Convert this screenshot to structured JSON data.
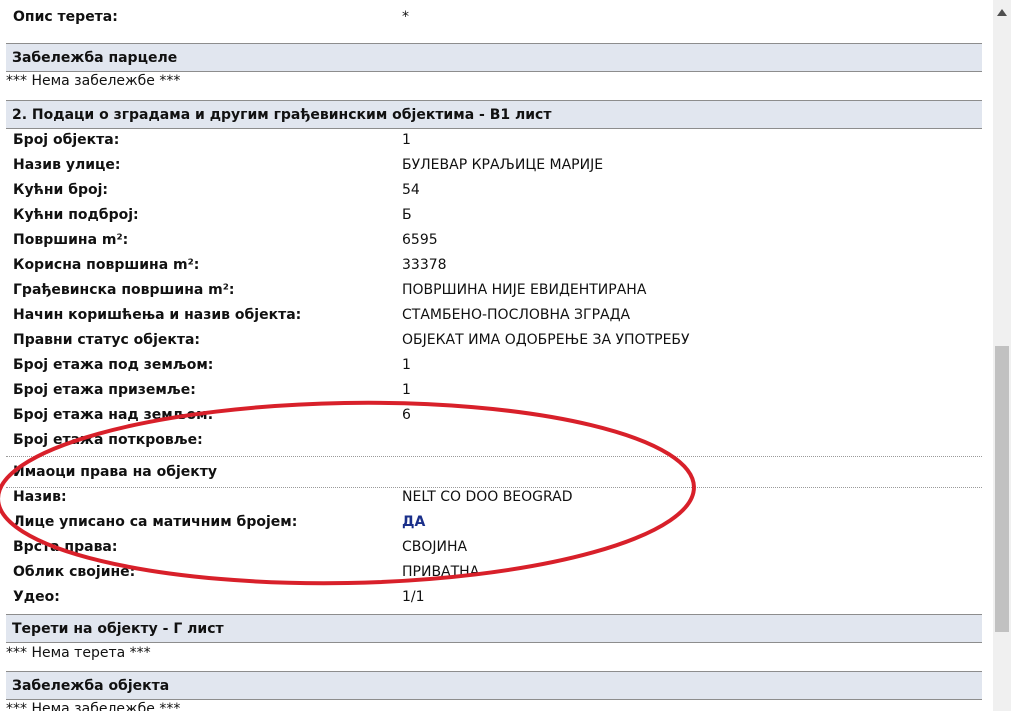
{
  "top_row": {
    "label": "Опис терета:",
    "value": "*"
  },
  "parcel_note": {
    "title": "Забележба парцеле",
    "text": "*** Нема забележбе ***"
  },
  "buildings": {
    "title": "2. Подаци о зградама и другим грађевинским објектима - В1 лист",
    "rows": [
      {
        "label": "Број објекта:",
        "value": "1"
      },
      {
        "label": "Назив улице:",
        "value": "БУЛЕВАР КРАЉИЦЕ МАРИЈЕ"
      },
      {
        "label": "Кућни број:",
        "value": "54"
      },
      {
        "label": "Кућни подброј:",
        "value": "Б"
      },
      {
        "label": "Површина m²:",
        "value": "6595"
      },
      {
        "label": "Корисна површина m²:",
        "value": "33378"
      },
      {
        "label": "Грађевинска површина m²:",
        "value": "ПОВРШИНА НИЈЕ ЕВИДЕНТИРАНА"
      },
      {
        "label": "Начин коришћења и назив објекта:",
        "value": "СТАМБЕНО-ПОСЛОВНА ЗГРАДА"
      },
      {
        "label": "Правни статус објекта:",
        "value": "ОБЈЕКАТ ИМА ОДОБРЕЊЕ ЗА УПОТРЕБУ"
      },
      {
        "label": "Број етажа под земљом:",
        "value": "1"
      },
      {
        "label": "Број етажа приземље:",
        "value": "1"
      },
      {
        "label": "Број етажа над земљом:",
        "value": "6"
      },
      {
        "label": "Број етажа поткровље:",
        "value": ""
      }
    ]
  },
  "owners": {
    "title": "Имаоци права на објекту",
    "rows": [
      {
        "label": "Назив:",
        "value": "NELT CO DOO BEOGRAD"
      },
      {
        "label": "Лице уписано са матичним бројем:",
        "value": "ДА"
      },
      {
        "label": "Врста права:",
        "value": "СВОЈИНА"
      },
      {
        "label": "Облик својине:",
        "value": "ПРИВАТНА"
      },
      {
        "label": "Удео:",
        "value": "1/1"
      }
    ]
  },
  "burdens": {
    "title": "Терети на објекту - Г лист",
    "text": "*** Нема терета ***"
  },
  "object_note": {
    "title": "Забележба објекта",
    "text": "*** Нема забележбе ***"
  },
  "colors": {
    "section_bg": "#e1e6ef",
    "link_value": "#1a2f8a",
    "annotation": "#d8202a"
  },
  "icons": {
    "scroll_up": "triangle-up-icon"
  }
}
